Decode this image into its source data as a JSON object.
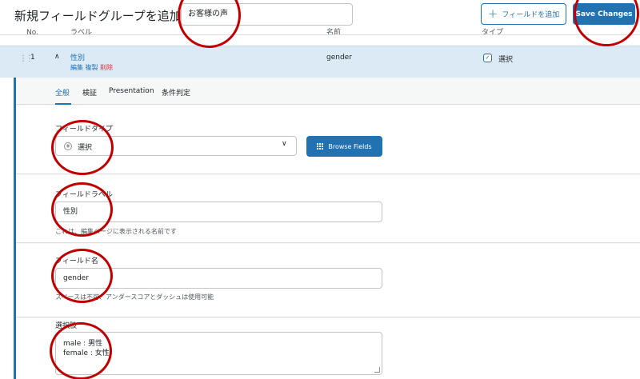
{
  "header": {
    "page_title": "新規フィールドグループを追加",
    "group_title_value": "お客様の声",
    "add_field_label": "フィールドを追加",
    "save_label": "Save Changes"
  },
  "table_headers": [
    "No.",
    "ラベル",
    "名前",
    "タイプ"
  ],
  "field_row": {
    "order": "1",
    "label": "性別",
    "action_edit": "編集",
    "action_duplicate": "複製",
    "action_delete": "削除",
    "name": "gender",
    "type": "選択"
  },
  "tabs": [
    "全般",
    "検証",
    "Presentation",
    "条件判定"
  ],
  "settings": {
    "field_type": {
      "title": "フィールドタイプ",
      "value": "選択",
      "browse_label": "Browse Fields"
    },
    "field_label": {
      "title": "フィールドラベル",
      "value": "性別",
      "help": "これは、編集ページに表示される名前です"
    },
    "field_name": {
      "title": "フィールド名",
      "value": "gender",
      "help": "スペースは不可、アンダースコアとダッシュは使用可能"
    },
    "choices": {
      "title": "選択肢",
      "lines": [
        "male : 男性",
        "female : 女性"
      ]
    }
  },
  "colors": {
    "accent": "#2271b1",
    "row_highlight": "#dbeaf4",
    "delete": "#d63638",
    "annotation": "#c00000"
  }
}
